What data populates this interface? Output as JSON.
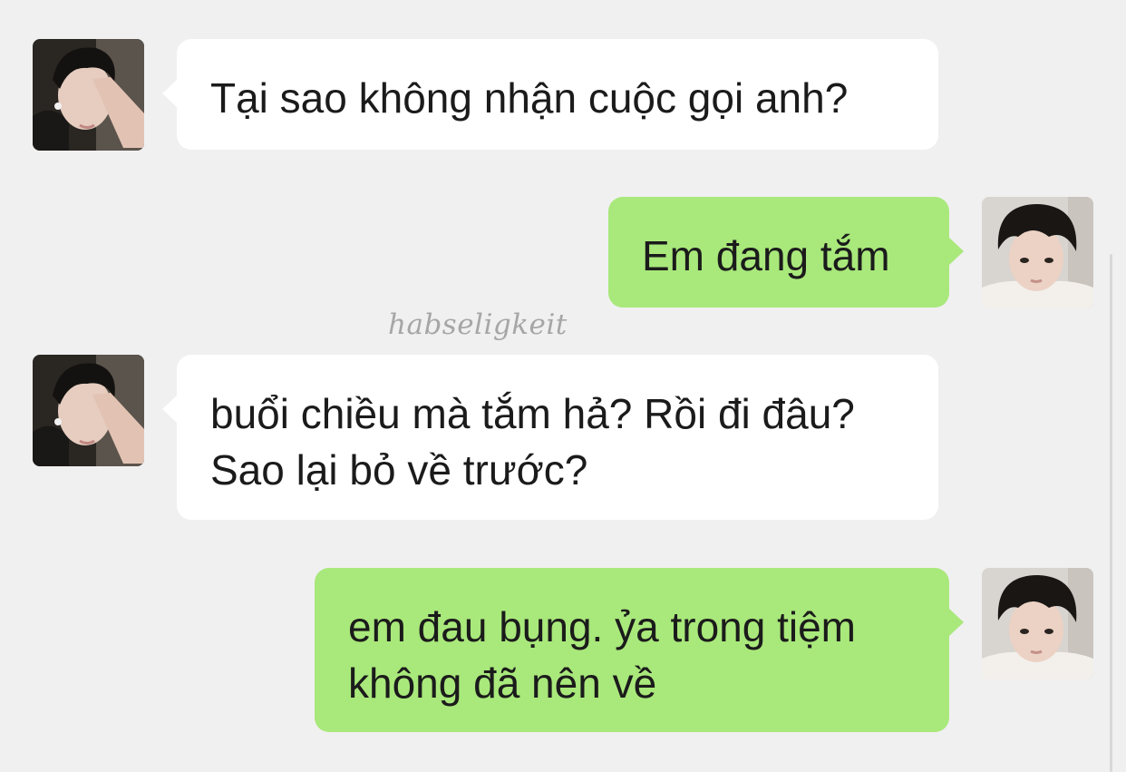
{
  "conversation": {
    "messages": [
      {
        "sender": "other",
        "text": "Tại sao không nhận cuộc gọi anh?"
      },
      {
        "sender": "me",
        "text": "Em đang tắm"
      },
      {
        "sender": "other",
        "text": "buổi chiều mà tắm hả? Rồi đi đâu?\nSao lại bỏ về trước?"
      },
      {
        "sender": "me",
        "text": "em đau bụng. ỷa trong tiệm\nkhông đã nên về"
      }
    ]
  },
  "watermark": "habseligkeit",
  "colors": {
    "background": "#f0f0f0",
    "incoming_bubble": "#ffffff",
    "outgoing_bubble": "#a9e87b",
    "text": "#1b1b1b"
  },
  "icons": {
    "other_avatar": "avatar-photo-other",
    "my_avatar": "avatar-photo-me"
  }
}
